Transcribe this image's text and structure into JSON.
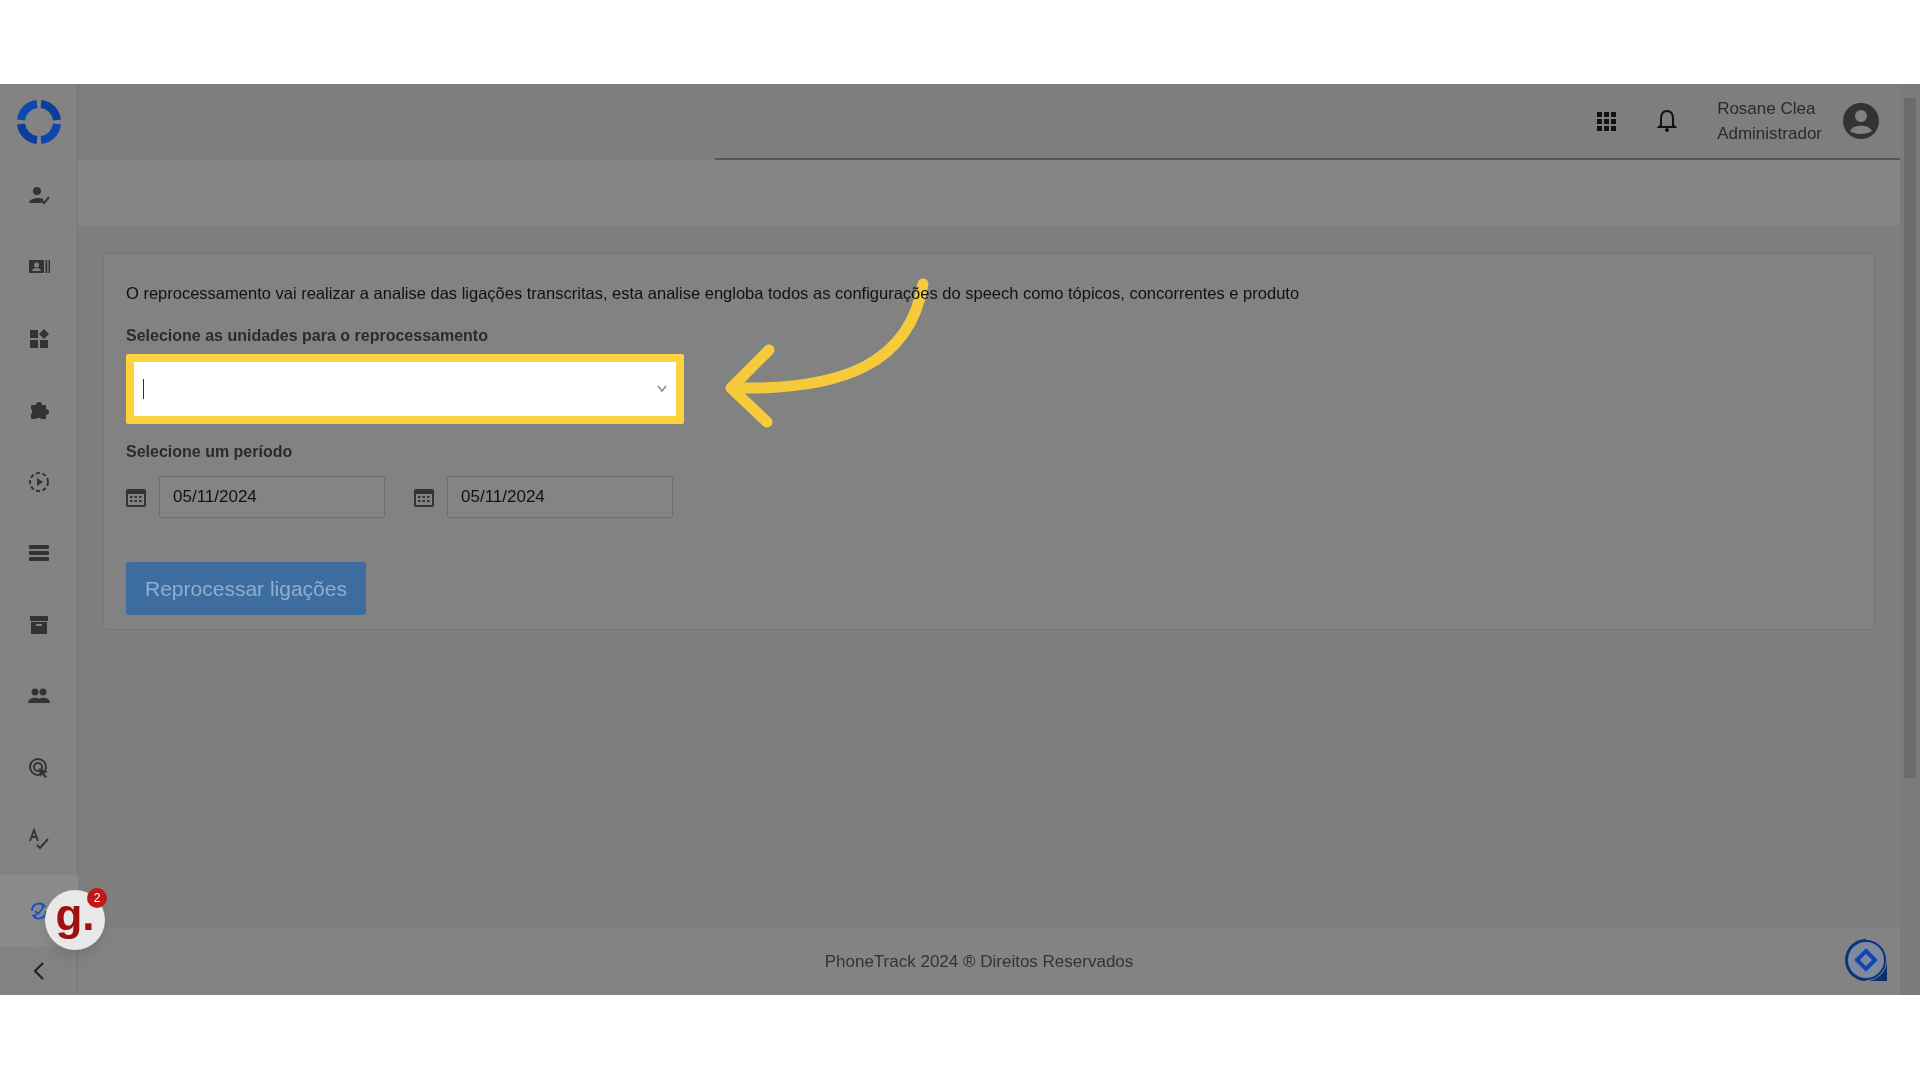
{
  "header": {
    "user_name": "Rosane Clea",
    "user_role": "Administrador"
  },
  "sidebar": {
    "items": [
      {
        "kind": "person-check",
        "selected": false
      },
      {
        "kind": "id-card",
        "selected": false
      },
      {
        "kind": "widgets",
        "selected": false
      },
      {
        "kind": "puzzle",
        "selected": false
      },
      {
        "kind": "play-circle",
        "selected": false
      },
      {
        "kind": "list",
        "selected": false
      },
      {
        "kind": "archive",
        "selected": false
      },
      {
        "kind": "group",
        "selected": false
      },
      {
        "kind": "target",
        "selected": false
      },
      {
        "kind": "spellcheck",
        "selected": false
      },
      {
        "kind": "sync",
        "selected": true
      }
    ]
  },
  "form": {
    "description": "O reprocessamento vai realizar a analise das ligações transcritas, esta analise engloba todos as configurações do speech como tópicos, concorrentes e produto",
    "units_label": "Selecione as unidades para o reprocessamento",
    "units_select": {
      "highlighted": true
    },
    "period_label": "Selecione um período",
    "start_date": "05/11/2024",
    "end_date": "05/11/2024",
    "submit": "Reprocessar ligações"
  },
  "footer": {
    "text": "PhoneTrack 2024 ® Direitos Reservados"
  },
  "widget": {
    "letter": "g.",
    "count": "2"
  }
}
